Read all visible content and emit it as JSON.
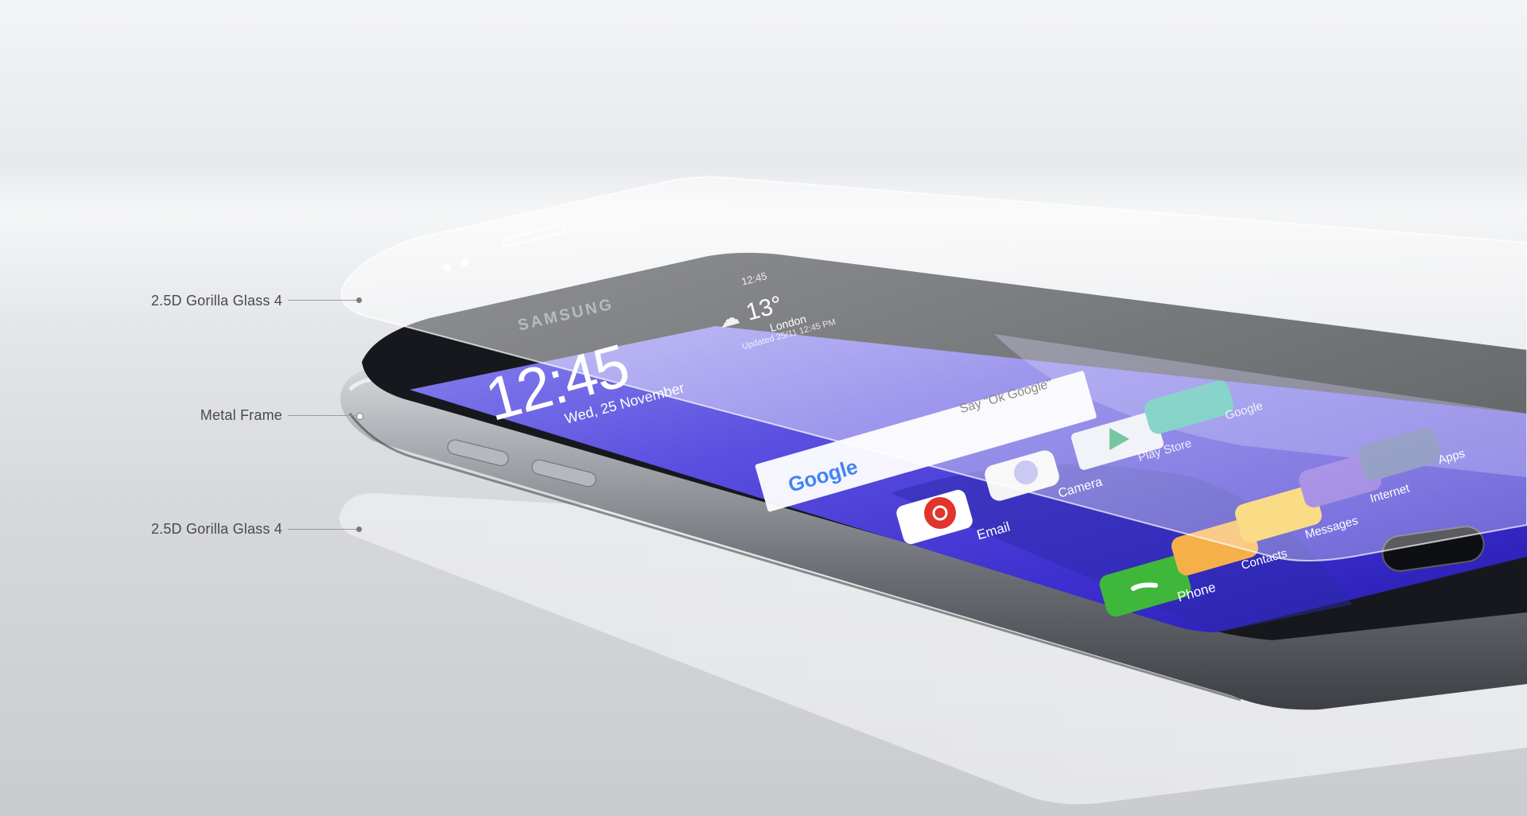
{
  "callouts": {
    "top_glass": "2.5D Gorilla Glass 4",
    "frame": "Metal Frame",
    "bottom_glass": "2.5D Gorilla Glass 4"
  },
  "phone": {
    "brand": "SAMSUNG",
    "status_time": "12:45",
    "clock": "12:45",
    "date": "Wed, 25 November",
    "weather_temp": "13°",
    "weather_location": "London",
    "weather_updated": "Updated 25/11 12:45 PM",
    "search_brand": "Google",
    "search_hint": "Say \"Ok Google\"",
    "apps": {
      "google": "Google",
      "play_store": "Play Store",
      "camera": "Camera",
      "email": "Email",
      "internet": "Internet",
      "messages": "Messages",
      "contacts": "Contacts",
      "phone": "Phone",
      "apps": "Apps"
    }
  },
  "colors": {
    "screen_top": "#7d7ce6",
    "screen_mid": "#4a3fd9",
    "screen_bottom": "#2a1fb8",
    "frame": "#8e9196",
    "bezel": "#1a1c21"
  }
}
